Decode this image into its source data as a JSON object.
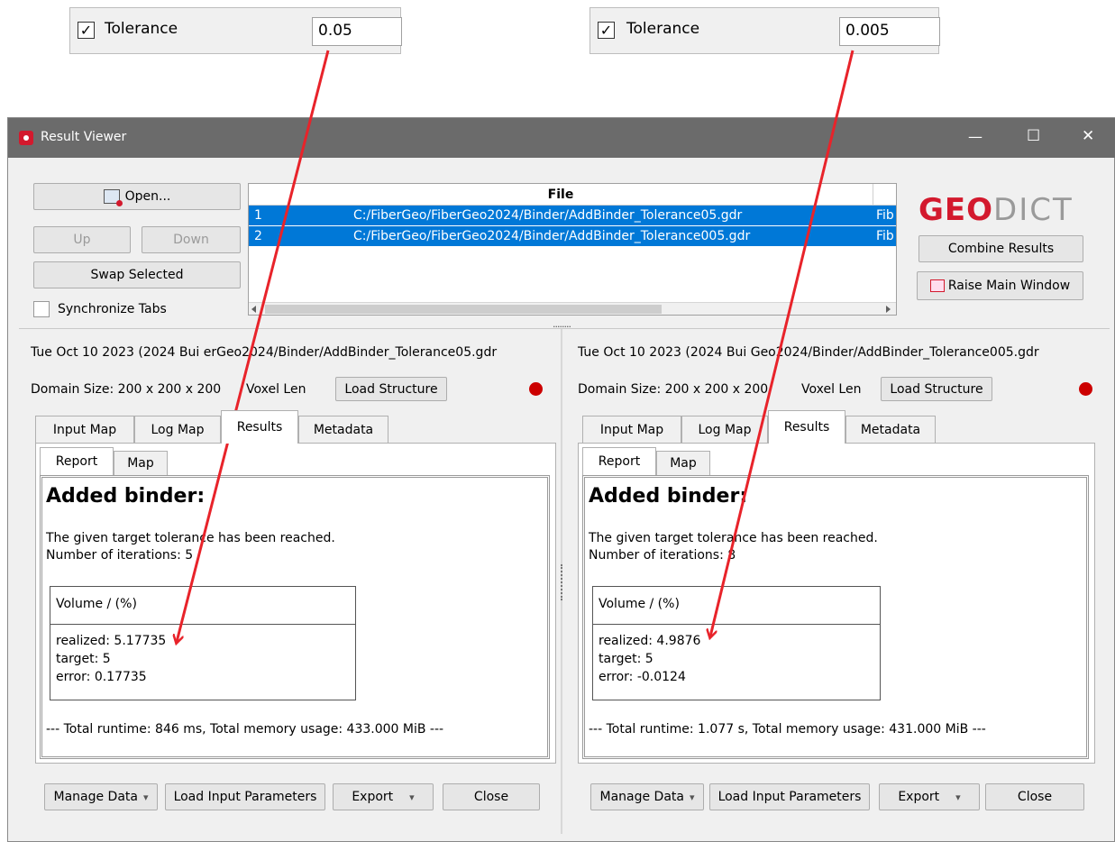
{
  "callouts": [
    {
      "label": "Tolerance",
      "value": "0.05",
      "checked": "✓"
    },
    {
      "label": "Tolerance",
      "value": "0.005",
      "checked": "✓"
    }
  ],
  "window": {
    "title": "Result Viewer",
    "controls": {
      "minimize": "—",
      "maximize": "☐",
      "close": "✕"
    }
  },
  "top": {
    "open_label": "Open...",
    "up_label": "Up",
    "down_label": "Down",
    "swap_label": "Swap Selected",
    "sync_label": "Synchronize Tabs",
    "file_header": "File",
    "files": [
      {
        "num": "1",
        "path": "C:/FiberGeo/FiberGeo2024/Binder/AddBinder_Tolerance05.gdr",
        "extra": "Fib"
      },
      {
        "num": "2",
        "path": "C:/FiberGeo/FiberGeo2024/Binder/AddBinder_Tolerance005.gdr",
        "extra": "Fib"
      }
    ],
    "logo_geo": "GEO",
    "logo_dict": "DICT",
    "combine_label": "Combine Results",
    "raise_label": "Raise Main Window",
    "splitter": "........"
  },
  "panels": [
    {
      "header_line1": "Tue Oct 10 2023 (2024 Bui erGeo2024/Binder/AddBinder_Tolerance05.gdr",
      "domain_label": "Domain Size: 200 x 200 x 200",
      "voxel_label": "Voxel Len",
      "load_structure": "Load Structure",
      "tabs": [
        "Input Map",
        "Log Map",
        "Results",
        "Metadata"
      ],
      "subtabs": [
        "Report",
        "Map"
      ],
      "report_title": "Added binder:",
      "line1": "The given target tolerance has been reached.",
      "line2": "Number of iterations: 5",
      "vol_header": "Volume / (%)",
      "realized": "realized: 5.17735",
      "target": "target: 5",
      "error": "error: 0.17735",
      "runtime": "--- Total runtime: 846 ms, Total memory usage: 433.000 MiB ---",
      "buttons": {
        "manage": "Manage Data",
        "load_input": "Load Input Parameters",
        "export": "Export",
        "close": "Close"
      }
    },
    {
      "header_line1": "Tue Oct 10 2023 (2024 Bui Geo2024/Binder/AddBinder_Tolerance005.gdr",
      "domain_label": "Domain Size: 200 x 200 x 200",
      "voxel_label": "Voxel Len",
      "load_structure": "Load Structure",
      "tabs": [
        "Input Map",
        "Log Map",
        "Results",
        "Metadata"
      ],
      "subtabs": [
        "Report",
        "Map"
      ],
      "report_title": "Added binder:",
      "line1": "The given target tolerance has been reached.",
      "line2": "Number of iterations: 8",
      "vol_header": "Volume / (%)",
      "realized": "realized: 4.9876",
      "target": "target: 5",
      "error": "error: -0.0124",
      "runtime": "--- Total runtime: 1.077 s, Total memory usage: 431.000 MiB ---",
      "buttons": {
        "manage": "Manage Data",
        "load_input": "Load Input Parameters",
        "export": "Export",
        "close": "Close"
      }
    }
  ],
  "dropdown_arrow": "▾",
  "colors": {
    "accent": "#0078d7",
    "logo": "#d3192d",
    "arrow": "#e8232a",
    "titlebar": "#6b6b6b"
  }
}
